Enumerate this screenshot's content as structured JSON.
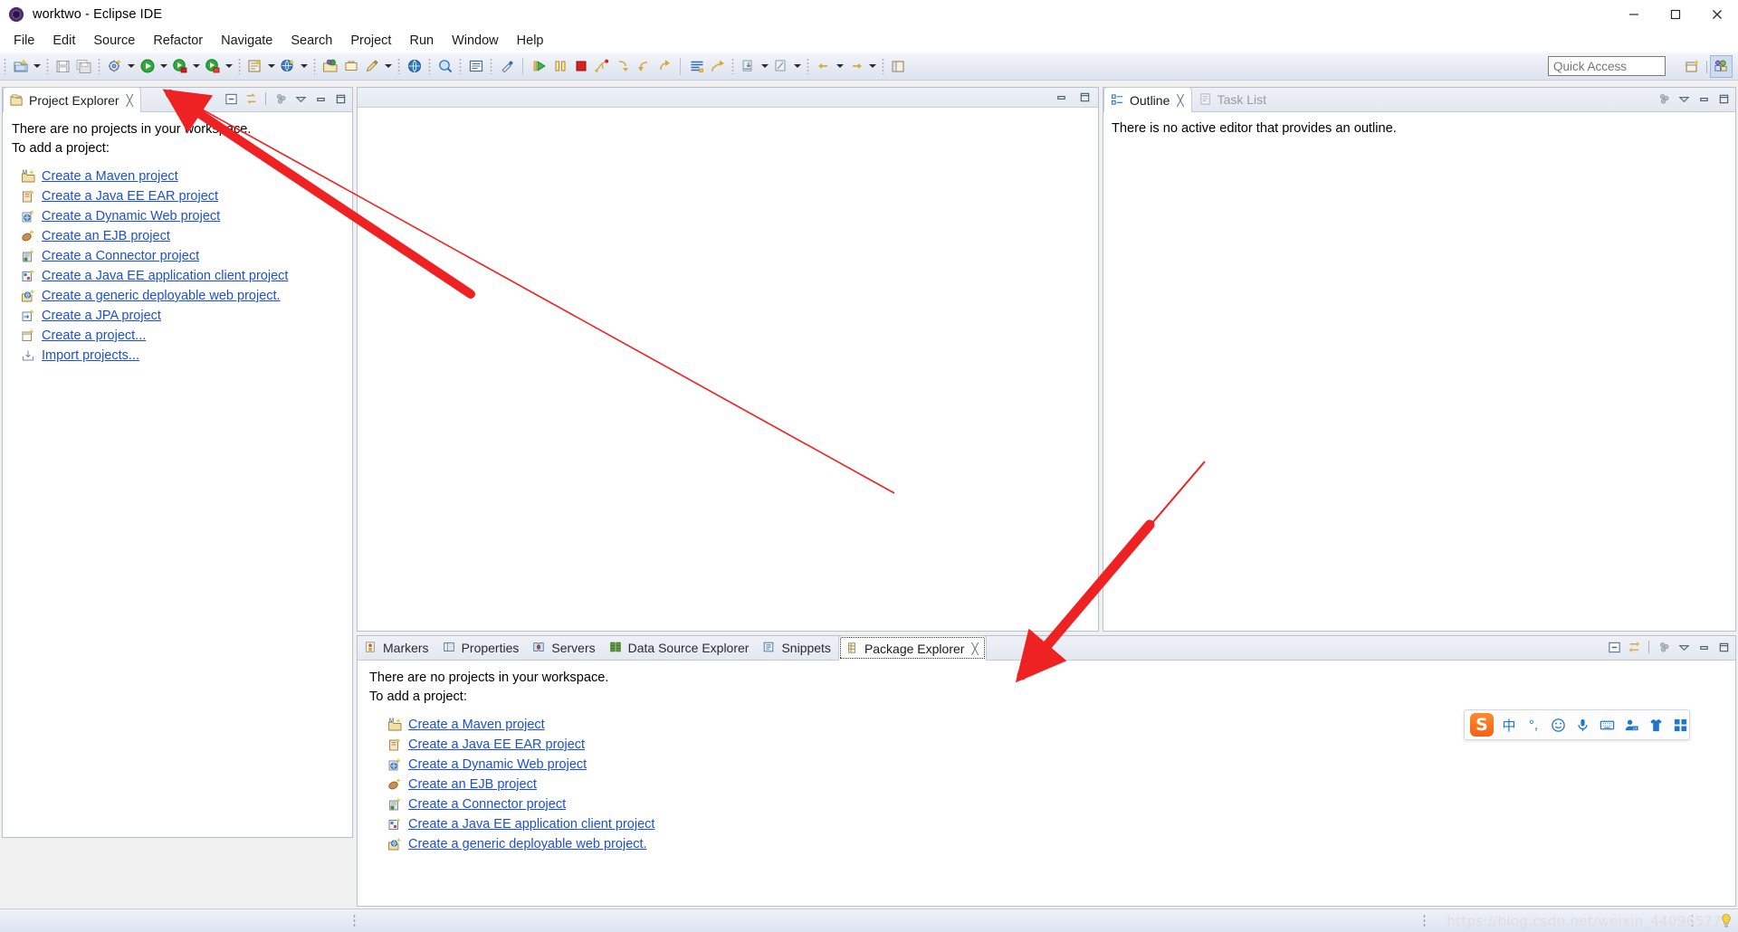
{
  "window": {
    "title": "worktwo - Eclipse IDE",
    "app_icon": "eclipse-icon",
    "minimize_label": "Minimize",
    "maximize_label": "Maximize",
    "close_label": "Close"
  },
  "menubar": {
    "items": [
      {
        "label": "File"
      },
      {
        "label": "Edit"
      },
      {
        "label": "Source"
      },
      {
        "label": "Refactor"
      },
      {
        "label": "Navigate"
      },
      {
        "label": "Search"
      },
      {
        "label": "Project"
      },
      {
        "label": "Run"
      },
      {
        "label": "Window"
      },
      {
        "label": "Help"
      }
    ]
  },
  "toolbar": {
    "quick_access_placeholder": "Quick Access",
    "quick_access_value": "",
    "icons": [
      "new-wizard-icon",
      "save-icon",
      "save-all-icon",
      "build-icon",
      "run-icon",
      "debug-icon",
      "run-as-icon",
      "new-java-class-icon",
      "new-java-project-icon",
      "open-type-icon",
      "open-task-icon",
      "edit-icon",
      "web-browser-icon",
      "search-icon",
      "console-icon",
      "toggle-mark-occurrences-icon",
      "step-over-icon",
      "pause-icon",
      "terminate-icon",
      "debug-breakpoint-icon",
      "forward-icon",
      "back-icon",
      "redo-icon",
      "annotation-icon",
      "next-annotation-icon",
      "previous-edit-icon",
      "back-nav-icon"
    ],
    "perspective_new_label": "Open Perspective",
    "perspective_active_label": "Java EE"
  },
  "project_explorer": {
    "tab_label": "Project Explorer",
    "tab_icon": "project-explorer-icon",
    "close_icon": "close-icon",
    "tools": [
      "collapse-all-icon",
      "link-with-editor-icon",
      "view-menu-icon",
      "minimize-icon",
      "maximize-icon"
    ],
    "empty_line1": "There are no projects in your workspace.",
    "empty_line2": "To add a project:",
    "links": [
      {
        "label": "Create a Maven project",
        "icon": "maven-project-icon"
      },
      {
        "label": "Create a Java EE EAR project",
        "icon": "ear-project-icon"
      },
      {
        "label": "Create a Dynamic Web project",
        "icon": "dynamic-web-project-icon"
      },
      {
        "label": "Create an EJB project",
        "icon": "ejb-project-icon"
      },
      {
        "label": "Create a Connector project",
        "icon": "connector-project-icon"
      },
      {
        "label": "Create a Java EE application client project",
        "icon": "app-client-project-icon"
      },
      {
        "label": "Create a generic deployable web project.",
        "icon": "generic-web-project-icon"
      },
      {
        "label": "Create a JPA project",
        "icon": "jpa-project-icon"
      },
      {
        "label": "Create a project...",
        "icon": "new-project-icon"
      },
      {
        "label": "Import projects...",
        "icon": "import-projects-icon"
      }
    ]
  },
  "editor_area": {
    "minimize_icon": "minimize-icon",
    "maximize_icon": "maximize-icon"
  },
  "outline": {
    "tabs": [
      {
        "label": "Outline",
        "icon": "outline-icon",
        "active": true,
        "closeable": true
      },
      {
        "label": "Task List",
        "icon": "task-list-icon",
        "active": false,
        "closeable": false
      }
    ],
    "close_icon": "close-icon",
    "tools": [
      "view-menu-filter-icon",
      "view-menu-icon",
      "minimize-icon",
      "maximize-icon"
    ],
    "message": "There is no active editor that provides an outline."
  },
  "bottom_panel": {
    "tabs": [
      {
        "label": "Markers",
        "icon": "markers-icon",
        "active": false
      },
      {
        "label": "Properties",
        "icon": "properties-icon",
        "active": false
      },
      {
        "label": "Servers",
        "icon": "servers-icon",
        "active": false
      },
      {
        "label": "Data Source Explorer",
        "icon": "data-source-explorer-icon",
        "active": false
      },
      {
        "label": "Snippets",
        "icon": "snippets-icon",
        "active": false
      },
      {
        "label": "Package Explorer",
        "icon": "package-explorer-icon",
        "active": true
      }
    ],
    "close_icon": "close-icon",
    "tools": [
      "collapse-all-icon",
      "link-with-editor-icon",
      "view-menu-filter-icon",
      "view-menu-icon",
      "minimize-icon",
      "maximize-icon"
    ],
    "empty_line1": "There are no projects in your workspace.",
    "empty_line2": "To add a project:",
    "links": [
      {
        "label": "Create a Maven project",
        "icon": "maven-project-icon"
      },
      {
        "label": "Create a Java EE EAR project",
        "icon": "ear-project-icon"
      },
      {
        "label": "Create a Dynamic Web project",
        "icon": "dynamic-web-project-icon"
      },
      {
        "label": "Create an EJB project",
        "icon": "ejb-project-icon"
      },
      {
        "label": "Create a Connector project",
        "icon": "connector-project-icon"
      },
      {
        "label": "Create a Java EE application client project",
        "icon": "app-client-project-icon"
      },
      {
        "label": "Create a generic deployable web project.",
        "icon": "generic-web-project-icon"
      }
    ]
  },
  "ime_bar": {
    "logo": "S",
    "items": [
      {
        "label": "中",
        "name": "chinese-english-toggle"
      },
      {
        "label": "°,",
        "name": "punctuation-toggle"
      },
      {
        "label": "☺",
        "name": "emoji-icon"
      },
      {
        "label": "🎤",
        "name": "voice-input-icon"
      },
      {
        "label": "⌨",
        "name": "soft-keyboard-icon"
      },
      {
        "label": "👤",
        "name": "user-icon"
      },
      {
        "label": "👕",
        "name": "skin-icon"
      },
      {
        "label": "▦",
        "name": "toolbox-icon"
      }
    ]
  },
  "statusbar": {
    "watermark": "https://blog.csdn.net/weixin_44096577",
    "tip_icon": "lightbulb-icon"
  },
  "annotations": [
    {
      "name": "arrow-to-project-explorer-tab",
      "color": "#ee2222"
    },
    {
      "name": "arrow-to-package-explorer-tab",
      "color": "#ee2222"
    }
  ]
}
